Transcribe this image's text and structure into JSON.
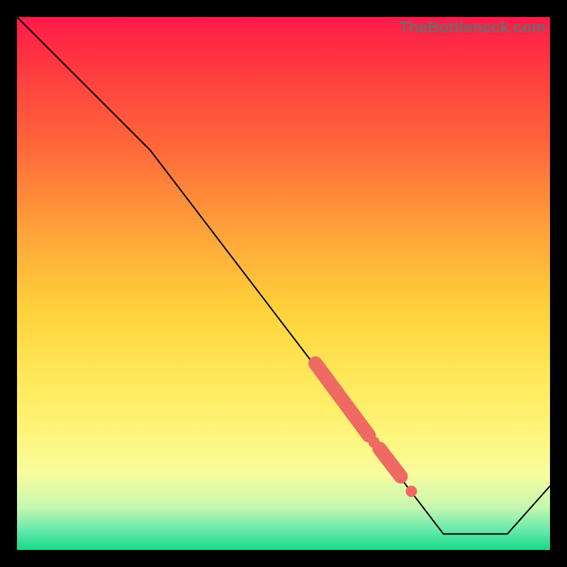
{
  "watermark": "TheBottleneck.com",
  "colors": {
    "cluster": "#ef6a63",
    "line": "#000000"
  },
  "chart_data": {
    "type": "line",
    "title": "",
    "xlabel": "",
    "ylabel": "",
    "xlim": [
      0,
      100
    ],
    "ylim": [
      0,
      100
    ],
    "grid": false,
    "series": [
      {
        "name": "curve",
        "x": [
          0,
          25,
          80,
          92,
          100
        ],
        "y": [
          100,
          75,
          3,
          3,
          12
        ]
      }
    ],
    "highlight_segments": [
      {
        "x0": 56,
        "y0": 35.0,
        "x1": 66,
        "y1": 21.5
      },
      {
        "x0": 68,
        "y0": 19.0,
        "x1": 72,
        "y1": 13.8
      }
    ],
    "highlight_points": [
      {
        "x": 67,
        "y": 20.2
      },
      {
        "x": 74,
        "y": 11.0
      }
    ],
    "annotations": []
  }
}
